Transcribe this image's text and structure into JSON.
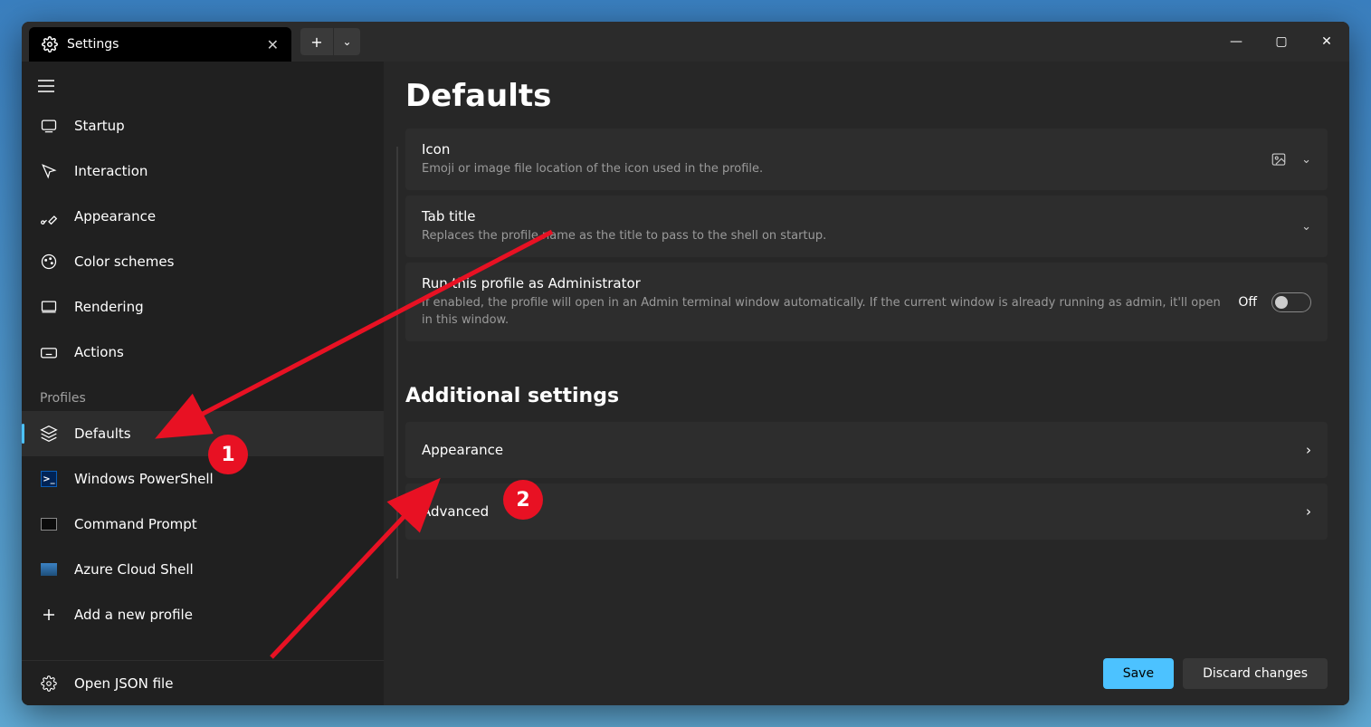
{
  "window": {
    "tab_title": "Settings",
    "minimize": "—",
    "maximize": "▢",
    "close": "✕"
  },
  "sidebar": {
    "items": [
      {
        "label": "Startup"
      },
      {
        "label": "Interaction"
      },
      {
        "label": "Appearance"
      },
      {
        "label": "Color schemes"
      },
      {
        "label": "Rendering"
      },
      {
        "label": "Actions"
      }
    ],
    "section_label": "Profiles",
    "profiles": [
      {
        "label": "Defaults"
      },
      {
        "label": "Windows PowerShell"
      },
      {
        "label": "Command Prompt"
      },
      {
        "label": "Azure Cloud Shell"
      },
      {
        "label": "Add a new profile"
      }
    ],
    "open_json": "Open JSON file"
  },
  "main": {
    "title": "Defaults",
    "cards": [
      {
        "title": "Icon",
        "desc": "Emoji or image file location of the icon used in the profile."
      },
      {
        "title": "Tab title",
        "desc": "Replaces the profile name as the title to pass to the shell on startup."
      },
      {
        "title": "Run this profile as Administrator",
        "desc": "If enabled, the profile will open in an Admin terminal window automatically. If the current window is already running as admin, it'll open in this window.",
        "toggle": "Off"
      }
    ],
    "additional_heading": "Additional settings",
    "additional": [
      {
        "label": "Appearance"
      },
      {
        "label": "Advanced"
      }
    ],
    "save": "Save",
    "discard": "Discard changes"
  },
  "annotations": {
    "one": "1",
    "two": "2"
  }
}
